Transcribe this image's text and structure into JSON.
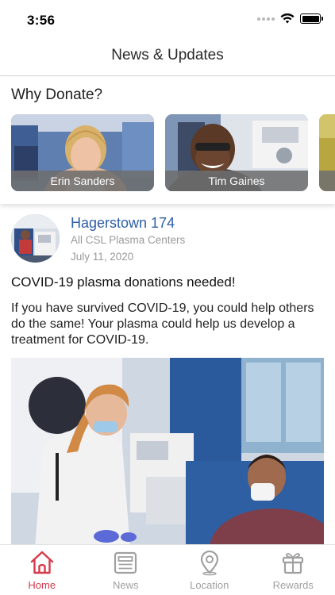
{
  "status_bar": {
    "time": "3:56"
  },
  "header": {
    "title": "News & Updates"
  },
  "why_donate": {
    "title": "Why Donate?",
    "stories": [
      {
        "name": "Erin Sanders"
      },
      {
        "name": "Tim Gaines"
      }
    ]
  },
  "post": {
    "location": "Hagerstown 174",
    "organization": "All CSL Plasma Centers",
    "date": "July 11, 2020",
    "headline": "COVID-19 plasma donations needed!",
    "body": "If you have survived COVID-19, you could help others do the same! Your plasma could help us develop a treatment for COVID-19."
  },
  "tab_bar": {
    "active": "Home",
    "tabs": [
      {
        "label": "Home",
        "icon": "home-icon"
      },
      {
        "label": "News",
        "icon": "news-icon"
      },
      {
        "label": "Location",
        "icon": "location-pin-icon"
      },
      {
        "label": "Rewards",
        "icon": "gift-icon"
      }
    ]
  },
  "colors": {
    "accent": "#d63a4c",
    "link": "#2d5fa8",
    "muted": "#9a9a9a"
  }
}
